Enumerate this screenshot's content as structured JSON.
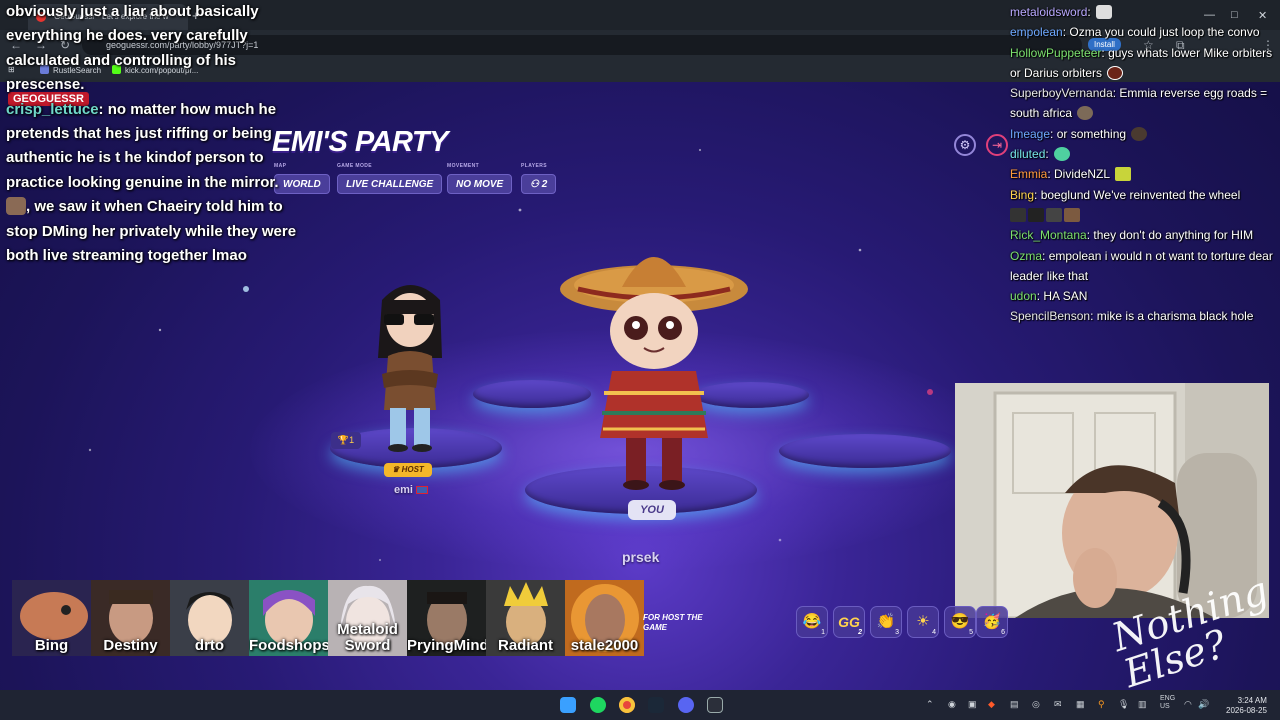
{
  "browser": {
    "tab_title": "GeoGuessr - Let's explore the w",
    "url": "geoguessr.com/party/lobby/977JT?j=1",
    "install_label": "Install",
    "bookmarks": [
      "RustleSearch",
      "kick.com/popout/pr..."
    ]
  },
  "stream_chat_left": {
    "line0": "obviously just a liar about basically everything he does. very carefully calculated and controlling of his prescense.",
    "user": "crisp_lettuce",
    "line1": ": no matter how much he pretends that hes just riffing or being authentic he is t he kindof person to practice looking genuine in the mirror.",
    "line2": ", we saw it when Chaeiry told him to stop DMing her privately while they were both live streaming together lmao"
  },
  "stream_chat_right": [
    {
      "user": "metaloidsword",
      "text": "",
      "color": "#b9a8ff"
    },
    {
      "user": "empolean",
      "text": "Ozma you could just loop the convo",
      "color": "#6ea8ff"
    },
    {
      "user": "HollowPuppeteer",
      "text": "guys whats lower Mike orbiters or Darius orbiters",
      "color": "#7ce06e"
    },
    {
      "user": "SuperboyVernanda",
      "text": "Emmia reverse egg roads = south africa",
      "color": "#e8e8e8"
    },
    {
      "user": "Imeage",
      "text": "or something",
      "color": "#6ea8ff"
    },
    {
      "user": "diluted",
      "text": "",
      "color": "#76e6e6"
    },
    {
      "user": "Emmia",
      "text": "DivideNZL",
      "color": "#ff9a3c"
    },
    {
      "user": "Bing",
      "text": "boeglund We've reinvented the wheel",
      "color": "#ffd34e"
    },
    {
      "user": "Rick_Montana",
      "text": "they don't do anything for HIM",
      "color": "#7ce06e"
    },
    {
      "user": "Ozma",
      "text": "empolean i would n ot want to torture dear leader like that",
      "color": "#7ce06e"
    },
    {
      "user": "udon",
      "text": "HA SAN",
      "color": "#7ce06e"
    },
    {
      "user": "SpencilBenson",
      "text": "mike is a charisma black hole",
      "color": "#e8e8e8"
    }
  ],
  "game": {
    "logo": "GEOGUESSR",
    "party_title": "EMI'S PARTY",
    "settings": [
      {
        "label": "MAP",
        "value": "WORLD"
      },
      {
        "label": "GAME MODE",
        "value": "LIVE CHALLENGE"
      },
      {
        "label": "MOVEMENT",
        "value": "NO MOVE"
      },
      {
        "label": "PLAYERS",
        "value": "2"
      }
    ],
    "host_name": "emi",
    "host_badge": "HOST",
    "host_trophies": "1",
    "you_badge": "YOU",
    "player_name": "prsek",
    "wait_note": "FOR HOST THE GAME"
  },
  "members": [
    "Bing",
    "Destiny",
    "drto",
    "Foodshops",
    "Metaloid Sword",
    "PryingMind",
    "Radiant",
    "stale2000"
  ],
  "reactions": [
    {
      "icon": "laugh-icon",
      "count": "1"
    },
    {
      "icon": "gg-icon",
      "count": "2",
      "text": "GG"
    },
    {
      "icon": "clap-icon",
      "count": "3"
    },
    {
      "icon": "sun-icon",
      "count": "4"
    },
    {
      "icon": "cool-icon",
      "count": "5"
    },
    {
      "icon": "party-icon",
      "count": "6"
    }
  ],
  "taskbar": {
    "lang1": "ENG",
    "lang2": "US",
    "time": "3:24 AM",
    "date": "2026-08-25"
  },
  "overlay_logo": "Nothing Else?",
  "colors": {
    "accent": "#6e61c4",
    "host": "#f4b729",
    "uname": "#6fd7c8"
  }
}
